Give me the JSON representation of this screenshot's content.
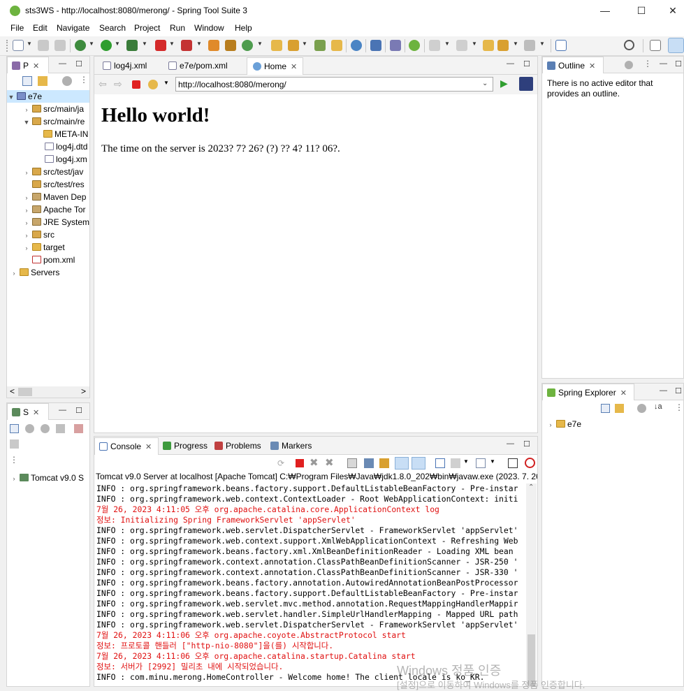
{
  "window": {
    "title": "sts3WS - http://localhost:8080/merong/ - Spring Tool Suite 3",
    "controls": {
      "minimize": "—",
      "maximize": "☐",
      "close": "✕"
    }
  },
  "menu": [
    "File",
    "Edit",
    "Navigate",
    "Search",
    "Project",
    "Run",
    "Window",
    "Help"
  ],
  "package_explorer": {
    "tab_label": "P",
    "items": [
      {
        "label": "e7e"
      },
      {
        "label": "src/main/ja"
      },
      {
        "label": "src/main/re"
      },
      {
        "label": "META-IN"
      },
      {
        "label": "log4j.dtd"
      },
      {
        "label": "log4j.xm"
      },
      {
        "label": "src/test/jav"
      },
      {
        "label": "src/test/res"
      },
      {
        "label": "Maven Dep"
      },
      {
        "label": "Apache Tor"
      },
      {
        "label": "JRE System"
      },
      {
        "label": "src"
      },
      {
        "label": "target"
      },
      {
        "label": "pom.xml"
      },
      {
        "label": "Servers"
      }
    ],
    "scroll_left": "<",
    "scroll_right": ">"
  },
  "servers_view": {
    "tab_label": "S",
    "items": [
      {
        "label": "Tomcat v9.0 S"
      }
    ]
  },
  "editor": {
    "tabs": [
      {
        "label": "log4j.xml"
      },
      {
        "label": "e7e/pom.xml"
      },
      {
        "label": "Home"
      }
    ],
    "url": "http://localhost:8080/merong/",
    "page": {
      "heading": "Hello world!",
      "body": "The time on the server is 2023? 7? 26? (?) ?? 4? 11? 06?."
    }
  },
  "outline": {
    "tab_label": "Outline",
    "message": "There is no active editor that provides an outline."
  },
  "spring_explorer": {
    "tab_label": "Spring Explorer",
    "items": [
      {
        "label": "e7e"
      }
    ]
  },
  "console": {
    "tabs": [
      {
        "label": "Console"
      },
      {
        "label": "Progress"
      },
      {
        "label": "Problems"
      },
      {
        "label": "Markers"
      }
    ],
    "header": "Tomcat v9.0 Server at localhost [Apache Tomcat] C:₩Program Files₩Java₩jdk1.8.0_202₩bin₩javaw.exe  (2023. 7. 26",
    "lines": [
      {
        "text": "INFO : org.springframework.beans.factory.support.DefaultListableBeanFactory - Pre-instar",
        "level": "info"
      },
      {
        "text": "INFO : org.springframework.web.context.ContextLoader - Root WebApplicationContext: initi",
        "level": "info"
      },
      {
        "text": "7월 26, 2023 4:11:05 오후 org.apache.catalina.core.ApplicationContext log",
        "level": "err"
      },
      {
        "text": "정보: Initializing Spring FrameworkServlet 'appServlet'",
        "level": "err"
      },
      {
        "text": "INFO : org.springframework.web.servlet.DispatcherServlet - FrameworkServlet 'appServlet'",
        "level": "info"
      },
      {
        "text": "INFO : org.springframework.web.context.support.XmlWebApplicationContext - Refreshing Web",
        "level": "info"
      },
      {
        "text": "INFO : org.springframework.beans.factory.xml.XmlBeanDefinitionReader - Loading XML bean",
        "level": "info"
      },
      {
        "text": "INFO : org.springframework.context.annotation.ClassPathBeanDefinitionScanner - JSR-250 '",
        "level": "info"
      },
      {
        "text": "INFO : org.springframework.context.annotation.ClassPathBeanDefinitionScanner - JSR-330 '",
        "level": "info"
      },
      {
        "text": "INFO : org.springframework.beans.factory.annotation.AutowiredAnnotationBeanPostProcessor",
        "level": "info"
      },
      {
        "text": "INFO : org.springframework.beans.factory.support.DefaultListableBeanFactory - Pre-instar",
        "level": "info"
      },
      {
        "text": "INFO : org.springframework.web.servlet.mvc.method.annotation.RequestMappingHandlerMappir",
        "level": "info"
      },
      {
        "text": "INFO : org.springframework.web.servlet.handler.SimpleUrlHandlerMapping - Mapped URL path",
        "level": "info"
      },
      {
        "text": "INFO : org.springframework.web.servlet.DispatcherServlet - FrameworkServlet 'appServlet'",
        "level": "info"
      },
      {
        "text": "7월 26, 2023 4:11:06 오후 org.apache.coyote.AbstractProtocol start",
        "level": "err"
      },
      {
        "text": "정보: 프로토콜 핸들러 [\"http-nio-8080\"]을(를) 시작합니다.",
        "level": "err"
      },
      {
        "text": "7월 26, 2023 4:11:06 오후 org.apache.catalina.startup.Catalina start",
        "level": "err"
      },
      {
        "text": "정보: 서버가 [2992] 밀리초 내에 시작되었습니다.",
        "level": "err"
      },
      {
        "text": "INFO : com.minu.merong.HomeController - Welcome home! The client locale is ko_KR.",
        "level": "info"
      }
    ]
  },
  "watermark": {
    "line1": "Windows 정품 인증",
    "line2": "[설정]으로 이동하여 Windows를 정품 인증합니다."
  },
  "colors": {
    "spring_green": "#6db33f",
    "error_red": "#e01010",
    "selection_blue": "#cce8ff"
  }
}
